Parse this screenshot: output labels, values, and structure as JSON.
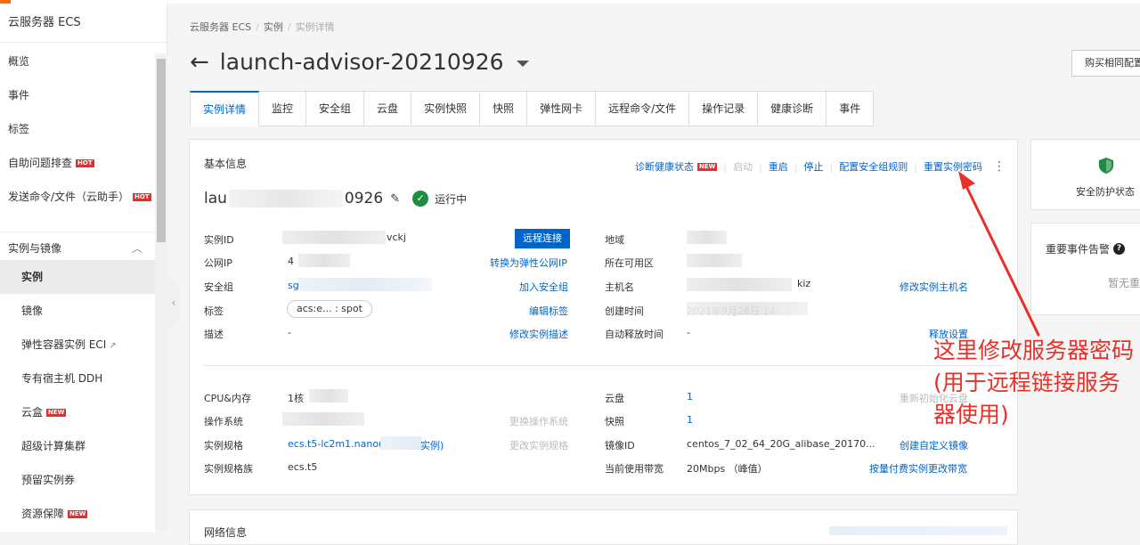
{
  "sidebar": {
    "title": "云服务器 ECS",
    "items_top": [
      {
        "label": "概览"
      },
      {
        "label": "事件"
      },
      {
        "label": "标签"
      },
      {
        "label": "自助问题排查",
        "badge": "HOT"
      },
      {
        "label": "发送命令/文件（云助手）",
        "badge": "HOT"
      }
    ],
    "section": "实例与镜像",
    "items_sub": [
      {
        "label": "实例"
      },
      {
        "label": "镜像"
      },
      {
        "label": "弹性容器实例 ECI"
      },
      {
        "label": "专有宿主机 DDH"
      },
      {
        "label": "云盒",
        "badge": "NEW"
      },
      {
        "label": "超级计算集群"
      },
      {
        "label": "预留实例券"
      },
      {
        "label": "资源保障",
        "badge": "NEW"
      }
    ]
  },
  "breadcrumb": [
    "云服务器 ECS",
    "实例",
    "实例详情"
  ],
  "title": "launch-advisor-20210926",
  "buy_button": "购买相同配置",
  "tabs": [
    "实例详情",
    "监控",
    "安全组",
    "云盘",
    "实例快照",
    "快照",
    "弹性网卡",
    "远程命令/文件",
    "操作记录",
    "健康诊断",
    "事件"
  ],
  "basic": {
    "title": "基本信息",
    "actions": {
      "diagnose": "诊断健康状态",
      "diagnose_badge": "NEW",
      "start": "启动",
      "restart": "重启",
      "stop": "停止",
      "sg_rules": "配置安全组规则",
      "reset_pwd": "重置实例密码"
    },
    "name_prefix": "lau",
    "name_suffix": "0926",
    "status": "运行中",
    "left_rows": [
      {
        "label": "实例ID",
        "value": "vckj",
        "action": "远程连接"
      },
      {
        "label": "公网IP",
        "value": "4",
        "action": "转换为弹性公网IP"
      },
      {
        "label": "安全组",
        "value": "sg",
        "action": "加入安全组"
      },
      {
        "label": "标签",
        "value": "acs:e... : spot",
        "action": "编辑标签"
      },
      {
        "label": "描述",
        "value": "-",
        "action": "修改实例描述"
      }
    ],
    "right_rows": [
      {
        "label": "地域",
        "value": "",
        "action": ""
      },
      {
        "label": "所在可用区",
        "value": "",
        "action": ""
      },
      {
        "label": "主机名",
        "value": "kiz",
        "action": "修改实例主机名"
      },
      {
        "label": "创建时间",
        "value": "2021年9月26日 14:",
        "action": ""
      },
      {
        "label": "自动释放时间",
        "value": "-",
        "action": "释放设置"
      }
    ],
    "left_rows2": [
      {
        "label": "CPU&内存",
        "value": "1核",
        "action": ""
      },
      {
        "label": "操作系统",
        "value": "",
        "action": "更换操作系统"
      },
      {
        "label": "实例规格",
        "value": "ecs.t5-lc2m1.nano(",
        "value2": "实例)",
        "action": "更改实例规格"
      },
      {
        "label": "实例规格族",
        "value": "ecs.t5",
        "action": ""
      }
    ],
    "right_rows2": [
      {
        "label": "云盘",
        "value": "1",
        "action": "重新初始化云盘"
      },
      {
        "label": "快照",
        "value": "1",
        "action": ""
      },
      {
        "label": "镜像ID",
        "value": "centos_7_02_64_20G_alibase_20170...",
        "action": "创建自定义镜像"
      },
      {
        "label": "当前使用带宽",
        "value": "20Mbps （峰值）",
        "action": "按量付费实例更改带宽"
      }
    ]
  },
  "network": {
    "title": "网络信息"
  },
  "right_panel": {
    "security": "安全防护状态",
    "alert_title": "重要事件告警",
    "alert_sub": "暂无重"
  },
  "annotation": {
    "text": "这里修改服务器密码(用于远程链接服务器使用)",
    "color": "#e8302a"
  }
}
